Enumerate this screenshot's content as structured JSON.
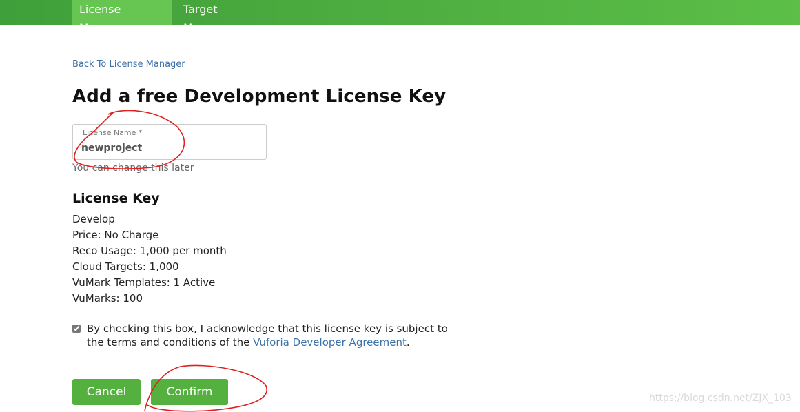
{
  "nav": {
    "tabs": [
      {
        "label": "License Manager",
        "active": true
      },
      {
        "label": "Target Manager",
        "active": false
      }
    ]
  },
  "back_link": "Back To License Manager",
  "title": "Add a free Development License Key",
  "license_name": {
    "label": "License Name *",
    "value": "newproject",
    "helper": "You can change this later"
  },
  "license_key": {
    "heading": "License Key",
    "details": [
      "Develop",
      "Price: No Charge",
      "Reco Usage: 1,000 per month",
      "Cloud Targets: 1,000",
      "VuMark Templates: 1 Active",
      "VuMarks: 100"
    ]
  },
  "agreement": {
    "checked": true,
    "text_before": "By checking this box, I acknowledge that this license key is subject to the terms and conditions of the ",
    "link_text": "Vuforia Developer Agreement",
    "text_after": "."
  },
  "buttons": {
    "cancel": "Cancel",
    "confirm": "Confirm"
  },
  "watermark": "https://blog.csdn.net/ZJX_103",
  "colors": {
    "nav_green": "#4bab3f",
    "active_tab": "#67c552",
    "button_green": "#55b13f",
    "link_blue": "#3d72a8",
    "annotation_red": "#e02020"
  }
}
